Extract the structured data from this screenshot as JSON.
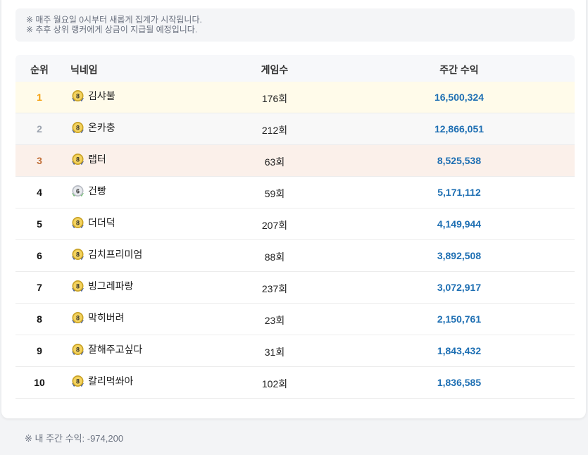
{
  "notice": {
    "line1": "※ 매주 월요일 0시부터 새롭게 집계가 시작됩니다.",
    "line2": "※ 추후 상위 랭커에게 상금이 지급될 예정입니다."
  },
  "table": {
    "headers": {
      "rank": "순위",
      "nickname": "닉네임",
      "games": "게임수",
      "income": "주간 수익"
    },
    "rows": [
      {
        "rank": "1",
        "nickname": "김샤불",
        "level": "8",
        "games": "176회",
        "income": "16,500,324"
      },
      {
        "rank": "2",
        "nickname": "온카충",
        "level": "8",
        "games": "212회",
        "income": "12,866,051"
      },
      {
        "rank": "3",
        "nickname": "랩터",
        "level": "8",
        "games": "63회",
        "income": "8,525,538"
      },
      {
        "rank": "4",
        "nickname": "건빵",
        "level": "6",
        "games": "59회",
        "income": "5,171,112"
      },
      {
        "rank": "5",
        "nickname": "더더덕",
        "level": "8",
        "games": "207회",
        "income": "4,149,944"
      },
      {
        "rank": "6",
        "nickname": "김치프리미엄",
        "level": "8",
        "games": "88회",
        "income": "3,892,508"
      },
      {
        "rank": "7",
        "nickname": "빙그레파랑",
        "level": "8",
        "games": "237회",
        "income": "3,072,917"
      },
      {
        "rank": "8",
        "nickname": "막히버려",
        "level": "8",
        "games": "23회",
        "income": "2,150,761"
      },
      {
        "rank": "9",
        "nickname": "잘해주고싶다",
        "level": "8",
        "games": "31회",
        "income": "1,843,432"
      },
      {
        "rank": "10",
        "nickname": "칼리먹쏴아",
        "level": "8",
        "games": "102회",
        "income": "1,836,585"
      }
    ]
  },
  "footer": {
    "my_income": "※ 내 주간 수익: -974,200"
  },
  "colors": {
    "income": "#1e6fb3",
    "gold": "#f59e0b",
    "silver": "#9ca3af",
    "bronze": "#c2703a"
  },
  "icons": {
    "level8": "level-8-badge-icon",
    "level6": "level-6-badge-icon"
  }
}
